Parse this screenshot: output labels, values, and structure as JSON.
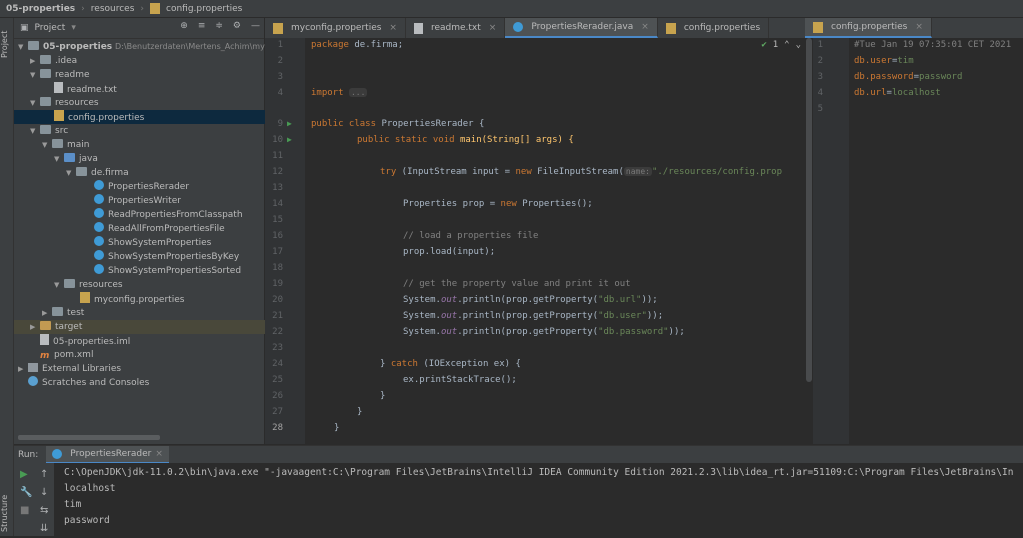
{
  "breadcrumb": {
    "project": "05-properties",
    "folder": "resources",
    "file": "config.properties"
  },
  "left_strip": {
    "project_tab": "Project",
    "structure_tab": "Structure"
  },
  "project_panel": {
    "title": "Project",
    "tree": [
      {
        "label": "05-properties",
        "path": "D:\\Benutzerdaten\\Mertens_Achim\\my-wo",
        "icon": "folder"
      },
      {
        "label": ".idea",
        "icon": "folder"
      },
      {
        "label": "readme",
        "icon": "folder"
      },
      {
        "label": "readme.txt",
        "icon": "file"
      },
      {
        "label": "resources",
        "icon": "folder"
      },
      {
        "label": "config.properties",
        "icon": "props"
      },
      {
        "label": "src",
        "icon": "folder"
      },
      {
        "label": "main",
        "icon": "folder"
      },
      {
        "label": "java",
        "icon": "folder-blue"
      },
      {
        "label": "de.firma",
        "icon": "package"
      },
      {
        "label": "PropertiesRerader",
        "icon": "java"
      },
      {
        "label": "PropertiesWriter",
        "icon": "java"
      },
      {
        "label": "ReadPropertiesFromClasspath",
        "icon": "java"
      },
      {
        "label": "ReadAllFromPropertiesFile",
        "icon": "java"
      },
      {
        "label": "ShowSystemProperties",
        "icon": "java"
      },
      {
        "label": "ShowSystemPropertiesByKey",
        "icon": "java"
      },
      {
        "label": "ShowSystemPropertiesSorted",
        "icon": "java"
      },
      {
        "label": "resources",
        "icon": "folder"
      },
      {
        "label": "myconfig.properties",
        "icon": "props"
      },
      {
        "label": "test",
        "icon": "folder"
      },
      {
        "label": "target",
        "icon": "folder-orange"
      },
      {
        "label": "05-properties.iml",
        "icon": "file"
      },
      {
        "label": "pom.xml",
        "icon": "xml"
      },
      {
        "label": "External Libraries",
        "icon": "library"
      },
      {
        "label": "Scratches and Consoles",
        "icon": "scratch"
      }
    ]
  },
  "tabs": [
    {
      "label": "myconfig.properties",
      "active": false
    },
    {
      "label": "readme.txt",
      "active": false
    },
    {
      "label": "PropertiesRerader.java",
      "active": true
    },
    {
      "label": "config.properties",
      "active": false
    }
  ],
  "right_tab": {
    "label": "config.properties"
  },
  "editor": {
    "problems_count": "1",
    "line_numbers": [
      "1",
      "2",
      "3",
      "4",
      "9",
      "10",
      "11",
      "12",
      "13",
      "14",
      "15",
      "16",
      "17",
      "18",
      "19",
      "20",
      "21",
      "22",
      "23",
      "24",
      "25",
      "26",
      "27",
      "28"
    ],
    "code": {
      "package_kw": "package",
      "package_name": " de.firma;",
      "import_kw": "import",
      "import_fold": "...",
      "class_line_a": "public class",
      "class_name": " PropertiesRerader {",
      "main_line_a": "public static void",
      "main_line_b": " main(String[] args) {",
      "try_kw": "try",
      "try_rest": " (InputStream input = ",
      "new_kw": "new",
      "fis": " FileInputStream(",
      "param_hint": "name:",
      "path_str": "\"./resources/config.prop",
      "props_a": "Properties prop = ",
      "props_b": " Properties();",
      "c1": "// load a properties file",
      "load": "prop.load(input);",
      "c2": "// get the property value and print it out",
      "sys": "System.",
      "out": "out",
      "println": ".println(prop.getProperty(",
      "s_url": "\"db.url\"",
      "s_user": "\"db.user\"",
      "s_pw": "\"db.password\"",
      "close_paren": "));",
      "catch_a": "} ",
      "catch_kw": "catch",
      "catch_b": " (IOException ex) {",
      "trace": "ex.printStackTrace();",
      "brace": "}"
    }
  },
  "right_editor": {
    "line_numbers": [
      "1",
      "2",
      "3",
      "4",
      "5"
    ],
    "comment": "#Tue Jan 19 07:35:01 CET 2021",
    "entries": [
      {
        "key": "db.user",
        "value": "tim"
      },
      {
        "key": "db.password",
        "value": "password"
      },
      {
        "key": "db.url",
        "value": "localhost"
      }
    ],
    "eq": "="
  },
  "run_panel": {
    "label": "Run:",
    "tab": "PropertiesRerader",
    "output": [
      "C:\\OpenJDK\\jdk-11.0.2\\bin\\java.exe \"-javaagent:C:\\Program Files\\JetBrains\\IntelliJ IDEA Community Edition 2021.2.3\\lib\\idea_rt.jar=51109:C:\\Program Files\\JetBrains\\In",
      "localhost",
      "tim",
      "password"
    ]
  },
  "colors": {
    "keyword": "#cc7832",
    "string": "#6a8759",
    "comment": "#808080",
    "selection": "#0d293e",
    "accent": "#4a88c7"
  }
}
